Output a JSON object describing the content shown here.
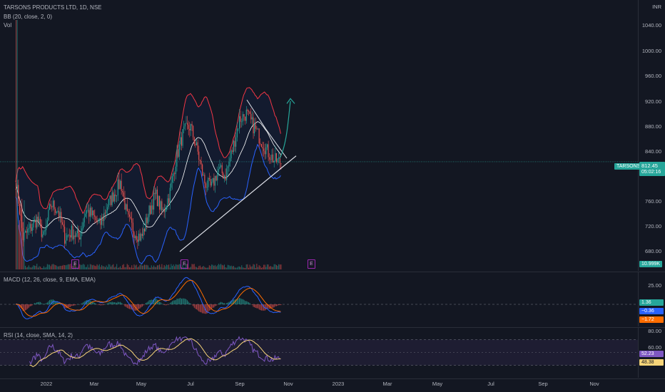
{
  "symbol": {
    "title": "TARSONS PRODUCTS LTD, 1D, NSE",
    "ticker": "TARSONS",
    "last_price": "812.45",
    "countdown": "05:02:16",
    "currency": "INR"
  },
  "indicators": {
    "bb": "BB (20, close, 2, 0)",
    "vol": "Vol",
    "macd": "MACD (12, 26, close, 9, EMA, EMA)",
    "rsi": "RSI (14, close, SMA, 14, 2)"
  },
  "price_axis": [
    "1040.00",
    "1000.00",
    "960.00",
    "920.00",
    "880.00",
    "840.00",
    "760.00",
    "720.00",
    "680.00"
  ],
  "volume_label": "10.999K",
  "macd_axis": {
    "tick": "25.00",
    "value1": "1.36",
    "value2": "−0.36",
    "value3": "−1.72"
  },
  "rsi_axis": {
    "t80": "80.00",
    "t60": "60.00",
    "value1": "52.23",
    "value2": "48.38"
  },
  "time_axis": [
    "2022",
    "Mar",
    "May",
    "Jul",
    "Sep",
    "Nov",
    "2023",
    "Mar",
    "May",
    "Jul",
    "Sep",
    "Nov"
  ],
  "earnings_markers": [
    "E",
    "E",
    "E"
  ],
  "colors": {
    "bg": "#131722",
    "up": "#26a69a",
    "down": "#ef5350",
    "bb_upper": "#f23645",
    "bb_lower": "#2962ff",
    "basis": "#ffffff",
    "macd": "#2962ff",
    "signal": "#ff6d00",
    "rsi": "#7e57c2",
    "rsi_ma": "#f7d479"
  },
  "chart_data": {
    "type": "candlestick",
    "title": "TARSONS PRODUCTS LTD, 1D, NSE",
    "x_range": [
      "2021-11-26",
      "2022-10-24"
    ],
    "ylim": [
      660,
      1060
    ],
    "last_close": 812.45,
    "series": [
      {
        "name": "close",
        "values": [
          780,
          690,
          705,
          720,
          690,
          745,
          735,
          690,
          700,
          690,
          735,
          725,
          710,
          740,
          760,
          780,
          720,
          700,
          690,
          730,
          760,
          730,
          760,
          820,
          860,
          870,
          830,
          780,
          770,
          800,
          790,
          830,
          880,
          890,
          870,
          850,
          830,
          815,
          812
        ]
      }
    ]
  }
}
